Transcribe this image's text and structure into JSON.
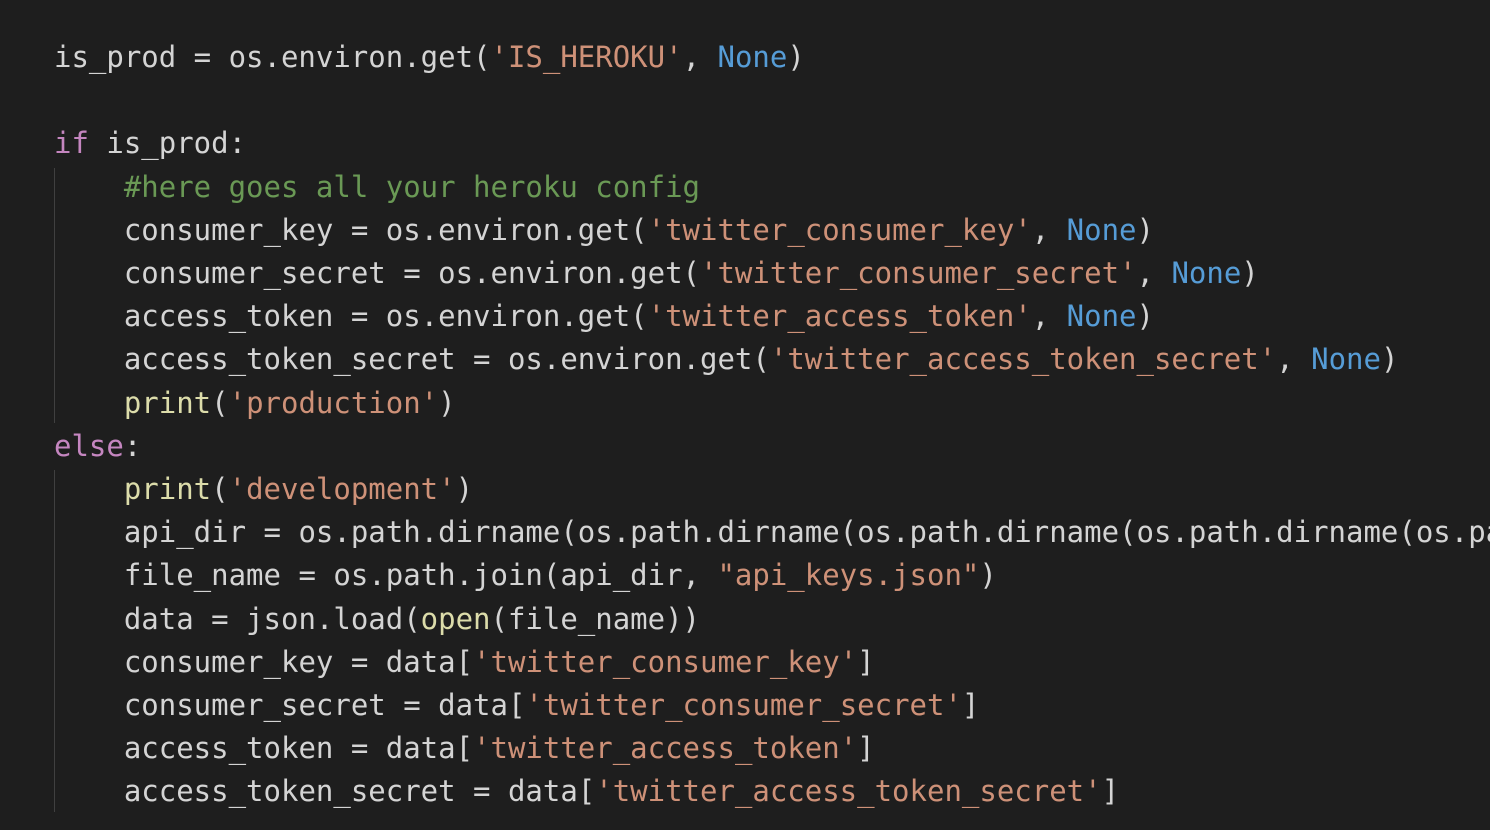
{
  "editor": {
    "language": "python",
    "theme_colors": {
      "background": "#1e1e1e",
      "text": "#d4d4d4",
      "keyword": "#c586c0",
      "string": "#ce9178",
      "constant": "#569cd6",
      "function": "#dcdcaa",
      "comment": "#6a9955",
      "indent_guide": "#404040"
    },
    "lines": [
      {
        "indent": 0,
        "tokens": [
          {
            "t": "id",
            "v": "is_prod = os.environ.get("
          },
          {
            "t": "str",
            "v": "'IS_HEROKU'"
          },
          {
            "t": "id",
            "v": ", "
          },
          {
            "t": "const",
            "v": "None"
          },
          {
            "t": "id",
            "v": ")"
          }
        ]
      },
      {
        "indent": 0,
        "tokens": []
      },
      {
        "indent": 0,
        "tokens": [
          {
            "t": "kw",
            "v": "if"
          },
          {
            "t": "id",
            "v": " is_prod:"
          }
        ]
      },
      {
        "indent": 1,
        "tokens": [
          {
            "t": "cm",
            "v": "#here goes all your heroku config"
          }
        ]
      },
      {
        "indent": 1,
        "tokens": [
          {
            "t": "id",
            "v": "consumer_key = os.environ.get("
          },
          {
            "t": "str",
            "v": "'twitter_consumer_key'"
          },
          {
            "t": "id",
            "v": ", "
          },
          {
            "t": "const",
            "v": "None"
          },
          {
            "t": "id",
            "v": ")"
          }
        ]
      },
      {
        "indent": 1,
        "tokens": [
          {
            "t": "id",
            "v": "consumer_secret = os.environ.get("
          },
          {
            "t": "str",
            "v": "'twitter_consumer_secret'"
          },
          {
            "t": "id",
            "v": ", "
          },
          {
            "t": "const",
            "v": "None"
          },
          {
            "t": "id",
            "v": ")"
          }
        ]
      },
      {
        "indent": 1,
        "tokens": [
          {
            "t": "id",
            "v": "access_token = os.environ.get("
          },
          {
            "t": "str",
            "v": "'twitter_access_token'"
          },
          {
            "t": "id",
            "v": ", "
          },
          {
            "t": "const",
            "v": "None"
          },
          {
            "t": "id",
            "v": ")"
          }
        ]
      },
      {
        "indent": 1,
        "tokens": [
          {
            "t": "id",
            "v": "access_token_secret = os.environ.get("
          },
          {
            "t": "str",
            "v": "'twitter_access_token_secret'"
          },
          {
            "t": "id",
            "v": ", "
          },
          {
            "t": "const",
            "v": "None"
          },
          {
            "t": "id",
            "v": ")"
          }
        ]
      },
      {
        "indent": 1,
        "tokens": [
          {
            "t": "fn",
            "v": "print"
          },
          {
            "t": "id",
            "v": "("
          },
          {
            "t": "str",
            "v": "'production'"
          },
          {
            "t": "id",
            "v": ")"
          }
        ]
      },
      {
        "indent": 0,
        "tokens": [
          {
            "t": "kw",
            "v": "else"
          },
          {
            "t": "id",
            "v": ":"
          }
        ]
      },
      {
        "indent": 1,
        "tokens": [
          {
            "t": "fn",
            "v": "print"
          },
          {
            "t": "id",
            "v": "("
          },
          {
            "t": "str",
            "v": "'development'"
          },
          {
            "t": "id",
            "v": ")"
          }
        ]
      },
      {
        "indent": 1,
        "tokens": [
          {
            "t": "id",
            "v": "api_dir = os.path.dirname(os.path.dirname(os.path.dirname(os.path.dirname(os.pa"
          }
        ]
      },
      {
        "indent": 1,
        "tokens": [
          {
            "t": "id",
            "v": "file_name = os.path.join(api_dir, "
          },
          {
            "t": "str",
            "v": "\"api_keys.json\""
          },
          {
            "t": "id",
            "v": ")"
          }
        ]
      },
      {
        "indent": 1,
        "tokens": [
          {
            "t": "id",
            "v": "data = json.load("
          },
          {
            "t": "fn",
            "v": "open"
          },
          {
            "t": "id",
            "v": "(file_name))"
          }
        ]
      },
      {
        "indent": 1,
        "tokens": [
          {
            "t": "id",
            "v": "consumer_key = data["
          },
          {
            "t": "str",
            "v": "'twitter_consumer_key'"
          },
          {
            "t": "id",
            "v": "]"
          }
        ]
      },
      {
        "indent": 1,
        "tokens": [
          {
            "t": "id",
            "v": "consumer_secret = data["
          },
          {
            "t": "str",
            "v": "'twitter_consumer_secret'"
          },
          {
            "t": "id",
            "v": "]"
          }
        ]
      },
      {
        "indent": 1,
        "tokens": [
          {
            "t": "id",
            "v": "access_token = data["
          },
          {
            "t": "str",
            "v": "'twitter_access_token'"
          },
          {
            "t": "id",
            "v": "]"
          }
        ]
      },
      {
        "indent": 1,
        "tokens": [
          {
            "t": "id",
            "v": "access_token_secret = data["
          },
          {
            "t": "str",
            "v": "'twitter_access_token_secret'"
          },
          {
            "t": "id",
            "v": "]"
          }
        ]
      }
    ]
  }
}
